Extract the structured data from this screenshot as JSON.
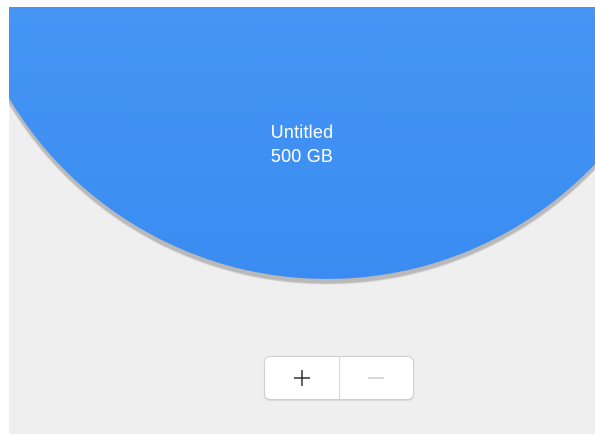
{
  "volume": {
    "name": "Untitled",
    "size": "500 GB",
    "color": "#4697f4"
  },
  "controls": {
    "add": {
      "icon": "plus-icon",
      "enabled": true
    },
    "remove": {
      "icon": "minus-icon",
      "enabled": false
    }
  },
  "colors": {
    "background": "#efefef",
    "volume_fill": "#4697f4",
    "icon_enabled": "#222222",
    "icon_disabled": "#c7c7c7"
  }
}
